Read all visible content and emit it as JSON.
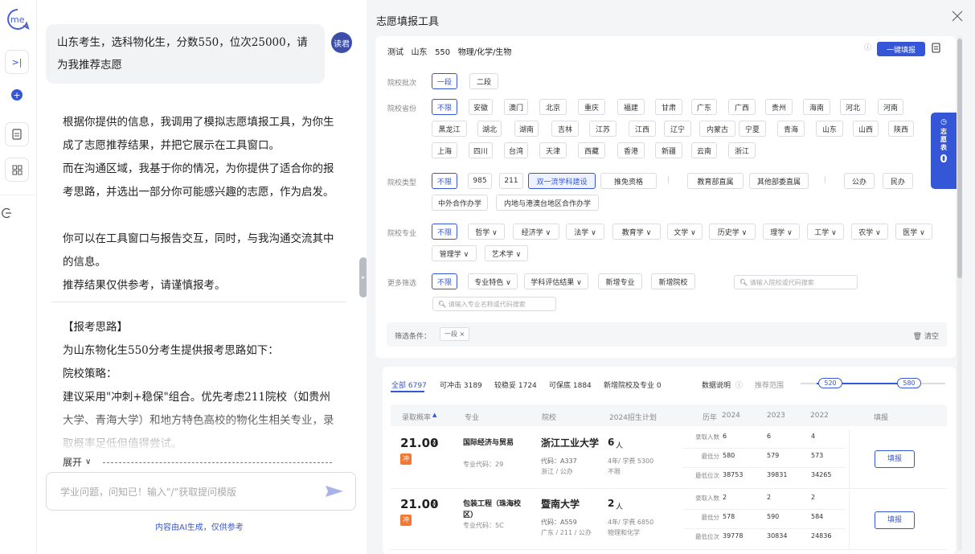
{
  "rail": {
    "logo": "me"
  },
  "chat": {
    "avatar": "读君",
    "user_msg": "山东考生，选科物化生，分数550，位次25000，请为我推荐志愿",
    "ai_para1": "根据你提供的信息，我调用了模拟志愿填报工具，为你生成了志愿推荐结果，并把它展示在工具窗口。",
    "ai_para2": "而在沟通区域，我基于你的情况，为你提供了适合你的报考思路，并选出一部分你可能感兴趣的志愿，作为启发。",
    "ai_para3": "你可以在工具窗口与报告交互，同时，与我沟通交流其中的信息。",
    "ai_para4": "推荐结果仅供参考，请谨慎报考。",
    "h_title": "【报考思路】",
    "h_line1": "为山东物化生550分考生提供报考思路如下：",
    "h_line2": "院校策略：",
    "h_line3": "建议采用\"冲刺+稳保\"组合。优先考虑211院校（如贵州大学、青海大学）和地方特色高校的物化生相关专业，录取概率足低但值得尝试。",
    "expand": "展开",
    "input_placeholder": "学业问题，问知已！输入\"/\"获取提问模版",
    "footer": "内容由AI生成，仅供参考"
  },
  "tool": {
    "title": "志愿填报工具",
    "profile": "测试   山东   550   物理/化学/生物",
    "one_click": "一键填报",
    "filters": {
      "batch_label": "院校批次",
      "batch": [
        "一段",
        "二段"
      ],
      "province_label": "院校省份",
      "provinces": [
        "不限",
        "安徽",
        "澳门",
        "北京",
        "重庆",
        "福建",
        "甘肃",
        "广东",
        "广西",
        "贵州",
        "海南",
        "河北",
        "河南",
        "黑龙江",
        "湖北",
        "湖南",
        "吉林",
        "江苏",
        "江西",
        "辽宁",
        "内蒙古",
        "宁夏",
        "青海",
        "山东",
        "山西",
        "陕西",
        "上海",
        "四川",
        "台湾",
        "天津",
        "西藏",
        "香港",
        "新疆",
        "云南",
        "浙江"
      ],
      "type_label": "院校类型",
      "types": [
        "不限",
        "985",
        "211",
        "双一流学科建设",
        "推免资格",
        "|",
        "教育部直属",
        "其他部委直属",
        "|",
        "公办",
        "民办",
        "中外合作办学",
        "内地与港澳台地区合作办学"
      ],
      "major_label": "院校专业",
      "majors": [
        "不限",
        "哲学 ∨",
        "经济学 ∨",
        "法学 ∨",
        "教育学 ∨",
        "文学 ∨",
        "历史学 ∨",
        "理学 ∨",
        "工学 ∨",
        "农学 ∨",
        "医学 ∨",
        "管理学 ∨",
        "艺术学 ∨"
      ],
      "more_label": "更多筛选",
      "more": [
        "不限",
        "专业特色 ∨",
        "学科评估结果 ∨",
        "新增专业",
        "新增院校"
      ],
      "school_search_ph": "请输入院校或代码搜索",
      "major_search_ph": "请输入专业名称或代码搜索",
      "cond_label": "筛选条件：",
      "cond_tag": "一段 ×",
      "clear": "清空"
    },
    "side_tab": {
      "text": "志愿表",
      "count": "0"
    },
    "result_tabs": [
      "全部 6797",
      "可冲击 3189",
      "较稳妥 1724",
      "可保底 1884",
      "新增院校及专业 0"
    ],
    "data_note": "数据说明",
    "range_label": "推荐范围",
    "range_low": "520",
    "range_high": "580",
    "table_headers": [
      "录取概率",
      "专业",
      "院校",
      "2024招生计划",
      "历年",
      "2024",
      "2023",
      "2022",
      "填报"
    ],
    "rows": [
      {
        "prob": "21.00",
        "pct": "%",
        "tag": "冲",
        "major": "国际经济与贸易",
        "major_code": "专业代码：29",
        "school": "浙江工业大学",
        "school_code": "代码：A337",
        "school_loc": "浙江 / 公办",
        "plan": "6",
        "plan_unit": "人",
        "plan_note1": "4年/ 学费 5300",
        "plan_note2": "不限",
        "hist_labels": [
          "录取人数",
          "最低分",
          "最低位次"
        ],
        "y2024": [
          "6",
          "580",
          "38753"
        ],
        "y2023": [
          "6",
          "579",
          "39831"
        ],
        "y2022": [
          "4",
          "573",
          "34265"
        ],
        "fill": "填报"
      },
      {
        "prob": "21.00",
        "pct": "%",
        "tag": "冲",
        "major": "包装工程（珠海校区）",
        "major_code": "专业代码：5C",
        "school": "暨南大学",
        "school_code": "代码：A559",
        "school_loc": "广东 / 211 / 公办",
        "plan": "2",
        "plan_unit": "人",
        "plan_note1": "4年/ 学费 6850",
        "plan_note2": "物理和化学",
        "hist_labels": [
          "录取人数",
          "最低分",
          "最低位次"
        ],
        "y2024": [
          "2",
          "578",
          "39778"
        ],
        "y2023": [
          "2",
          "590",
          "30834"
        ],
        "y2022": [
          "2",
          "584",
          "24836"
        ],
        "fill": "填报"
      }
    ]
  },
  "colors": {
    "accent": "#3556d6",
    "tag": "#f07a35"
  }
}
